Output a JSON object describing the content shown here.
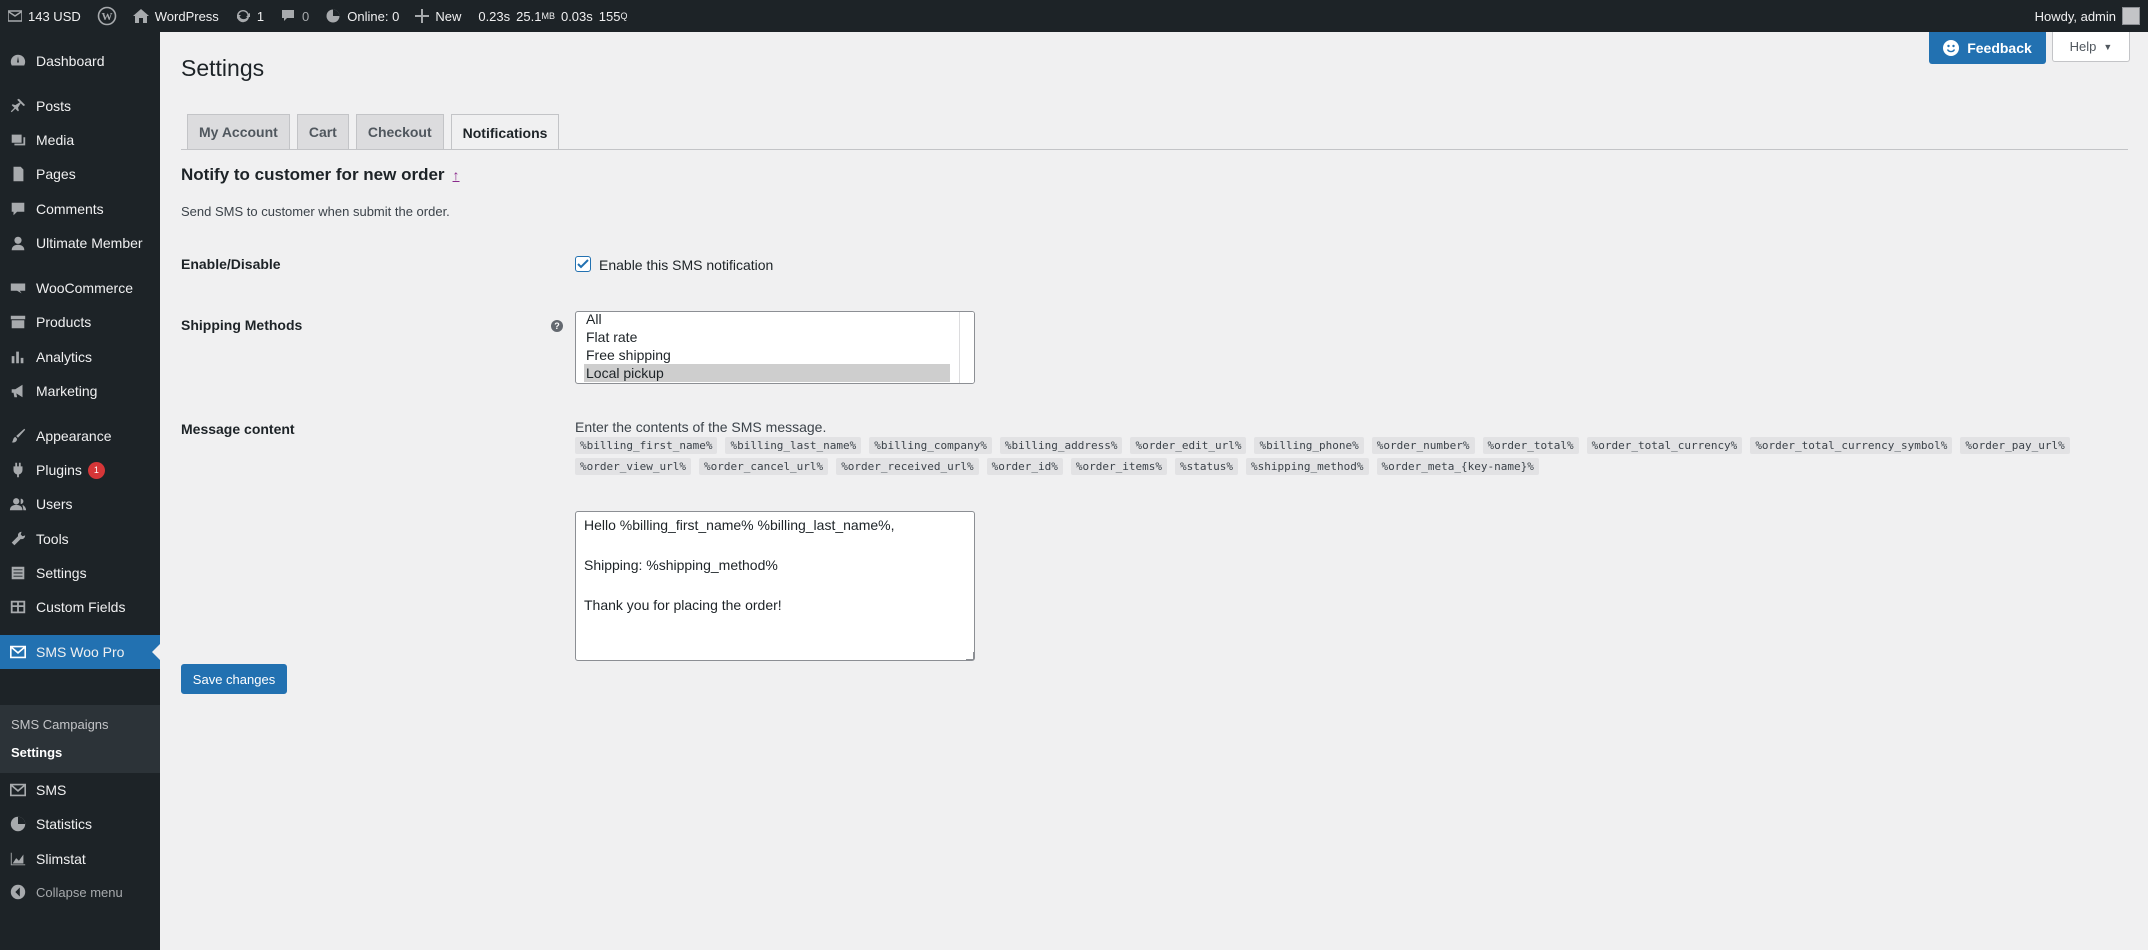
{
  "adminbar": {
    "sms_balance": "143 USD",
    "site_name": "WordPress",
    "updates_count": "1",
    "comments_count": "0",
    "online": "Online: 0",
    "new_label": "New",
    "perf_time": "0.23s",
    "perf_mem": "25.1",
    "perf_mem_unit": "MB",
    "perf_db_time": "0.03s",
    "perf_queries": "155",
    "perf_queries_unit": "Q",
    "howdy": "Howdy, admin"
  },
  "sidebar": {
    "dashboard": "Dashboard",
    "posts": "Posts",
    "media": "Media",
    "pages": "Pages",
    "comments": "Comments",
    "ultimate_member": "Ultimate Member",
    "woocommerce": "WooCommerce",
    "products": "Products",
    "analytics": "Analytics",
    "marketing": "Marketing",
    "appearance": "Appearance",
    "plugins": "Plugins",
    "plugins_badge": "1",
    "users": "Users",
    "tools": "Tools",
    "settings": "Settings",
    "custom_fields": "Custom Fields",
    "sms_woo_pro": "SMS Woo Pro",
    "sub_sms_campaigns": "SMS Campaigns",
    "sub_settings": "Settings",
    "sms": "SMS",
    "statistics": "Statistics",
    "slimstat": "Slimstat",
    "collapse": "Collapse menu"
  },
  "header": {
    "title": "Settings",
    "feedback_label": "Feedback",
    "help_label": "Help"
  },
  "tabs": [
    {
      "label": "My Account"
    },
    {
      "label": "Cart"
    },
    {
      "label": "Checkout"
    },
    {
      "label": "Notifications"
    }
  ],
  "section": {
    "title": "Notify to customer for new order",
    "up_link": "↑",
    "description": "Send SMS to customer when submit the order."
  },
  "form": {
    "enable_label": "Enable/Disable",
    "enable_checkbox_label": "Enable this SMS notification",
    "enable_checked": true,
    "shipping_label": "Shipping Methods",
    "help_tip": "?",
    "shipping_options": [
      "All",
      "Flat rate",
      "Free shipping",
      "Local pickup"
    ],
    "shipping_selected": "Local pickup",
    "message_label": "Message content",
    "message_intro": "Enter the contents of the SMS message.",
    "tags_row1": [
      "%billing_first_name%",
      "%billing_last_name%",
      "%billing_company%",
      "%billing_address%",
      "%order_edit_url%",
      "%billing_phone%",
      "%order_number%",
      "%order_total%",
      "%order_total_currency%",
      "%order_total_currency_symbol%",
      "%order_pay_url%"
    ],
    "tags_row2": [
      "%order_view_url%",
      "%order_cancel_url%",
      "%order_received_url%",
      "%order_id%",
      "%order_items%",
      "%status%",
      "%shipping_method%",
      "%order_meta_{key-name}%"
    ],
    "message_content": "Hello %billing_first_name% %billing_last_name%,\n\nShipping: %shipping_method%\n\nThank you for placing the order!",
    "save_label": "Save changes"
  }
}
